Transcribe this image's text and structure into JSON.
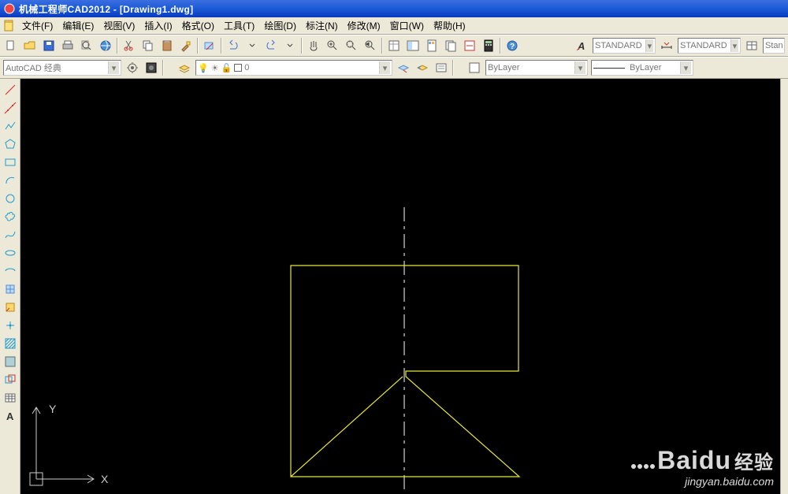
{
  "app": {
    "title": "机械工程师CAD2012 - [Drawing1.dwg]"
  },
  "menu": {
    "file": "文件(F)",
    "edit": "编辑(E)",
    "view": "视图(V)",
    "insert": "插入(I)",
    "format": "格式(O)",
    "tools": "工具(T)",
    "draw": "绘图(D)",
    "dim": "标注(N)",
    "modify": "修改(M)",
    "window": "窗口(W)",
    "help": "帮助(H)"
  },
  "combo": {
    "workspace": "AutoCAD 经典",
    "layer": "0",
    "textstyle1": "STANDARD",
    "textstyle2": "STANDARD",
    "stan": "Stan",
    "bylayer": "ByLayer",
    "bylayer_lt": "ByLayer"
  },
  "ucs": {
    "x": "X",
    "y": "Y"
  },
  "watermark": {
    "brand": "Baidu",
    "brand_cn": "经验",
    "url": "jingyan.baidu.com"
  }
}
